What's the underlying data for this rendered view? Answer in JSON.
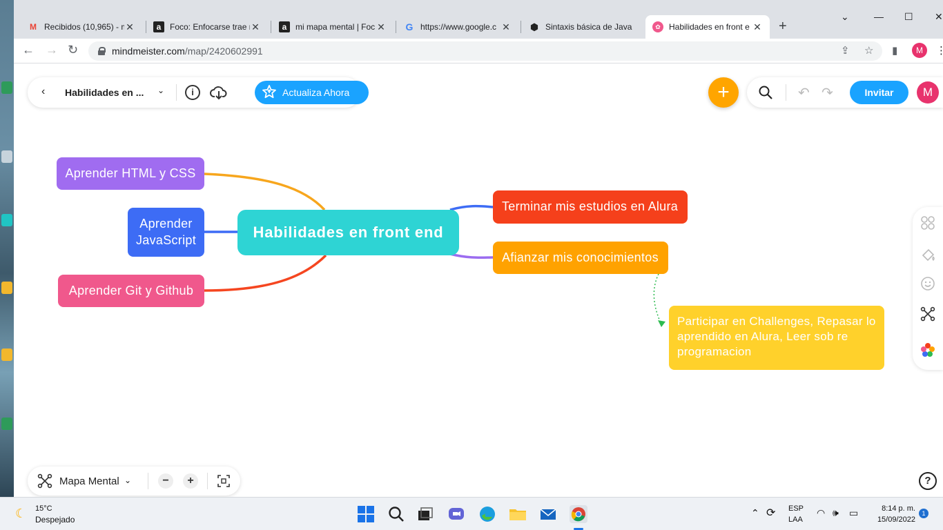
{
  "browser": {
    "tabs": [
      {
        "title": "Recibidos (10,965) - m",
        "icon": "gmail-icon"
      },
      {
        "title": "Foco: Enfocarse trae m",
        "icon": "alura-icon"
      },
      {
        "title": "mi mapa mental | Foc",
        "icon": "alura-icon"
      },
      {
        "title": "https://www.google.c",
        "icon": "google-icon"
      },
      {
        "title": "Sintaxis básica de Java",
        "icon": "hex-icon"
      },
      {
        "title": "Habilidades en front e",
        "icon": "mindmeister-icon"
      }
    ],
    "active_tab": 5,
    "url_host": "mindmeister.com",
    "url_path": "/map/2420602991",
    "profile_initial": "M"
  },
  "app": {
    "map_title": "Habilidades en ...",
    "upgrade_label": "Actualiza Ahora",
    "invite_label": "Invitar",
    "user_initial": "M",
    "layout_label": "Mapa Mental"
  },
  "mindmap": {
    "root": "Habilidades en front end",
    "left": [
      {
        "label": "Aprender HTML y CSS",
        "color": "#a06cf0"
      },
      {
        "label": "Aprender JavaScript",
        "color": "#3d6cf5"
      },
      {
        "label": "Aprender Git y Github",
        "color": "#f0588c"
      }
    ],
    "right": [
      {
        "label": "Terminar mis estudios en Alura",
        "color": "#f5401b"
      },
      {
        "label": "Afianzar mis conocimientos",
        "color": "#ffa200"
      }
    ],
    "note": {
      "label": "Participar en Challenges, Repasar lo aprendido en Alura, Leer sob re programacion",
      "color": "#ffd12b"
    },
    "root_color": "#2ed4d4",
    "connector_colors": {
      "html": "#f7a61d",
      "js": "#3d6cf5",
      "git": "#f54620",
      "alura": "#3d6cf5",
      "afianzar": "#9b6cf0",
      "note": "#2ebb50"
    }
  },
  "taskbar": {
    "temperature": "15°C",
    "weather": "Despejado",
    "lang_line1": "ESP",
    "lang_line2": "LAA",
    "time": "8:14 p. m.",
    "date": "15/09/2022",
    "notifications": "1"
  }
}
